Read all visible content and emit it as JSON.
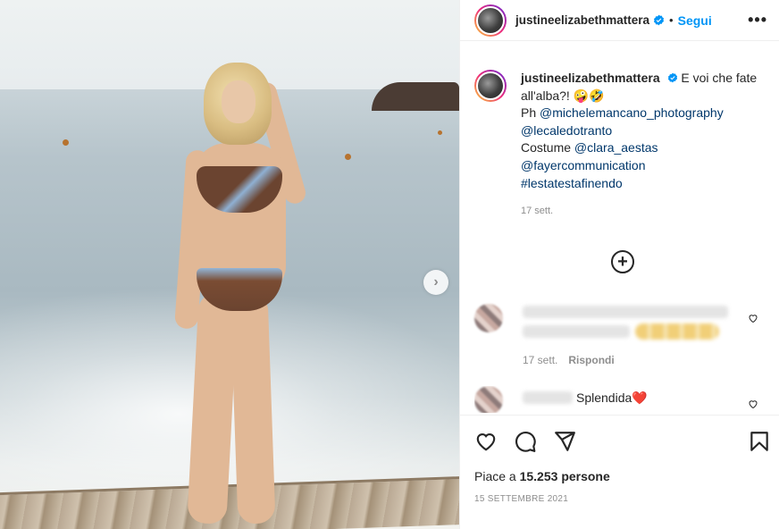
{
  "post": {
    "username": "justineelizabethmattera",
    "follow_label": "Segui",
    "more_label": "•••",
    "next_label": "›"
  },
  "caption": {
    "username": "justineelizabethmattera",
    "text_line1": "E voi che fate",
    "text_line2": "all'alba?! 🤪🤣",
    "ph_prefix": "Ph",
    "mention_photographer": "@michelemancano_photography",
    "mention_location": "@lecaledotranto",
    "costume_prefix": "Costume",
    "mention_costume": "@clara_aestas",
    "mention_agency": "@fayercommunication",
    "hashtag": "#lestatestafinendo",
    "time": "17 sett."
  },
  "load_more_label": "+",
  "comments": [
    {
      "time": "17 sett.",
      "reply_label": "Rispondi"
    },
    {
      "text": "Splendida",
      "emoji": "❤️"
    }
  ],
  "likes": {
    "prefix": "Piace a",
    "count": "15.253",
    "suffix": "persone"
  },
  "date": "15 SETTEMBRE 2021",
  "colors": {
    "accent": "#0095f6",
    "link": "#00376b",
    "muted": "#8e8e8e",
    "text": "#262626"
  }
}
